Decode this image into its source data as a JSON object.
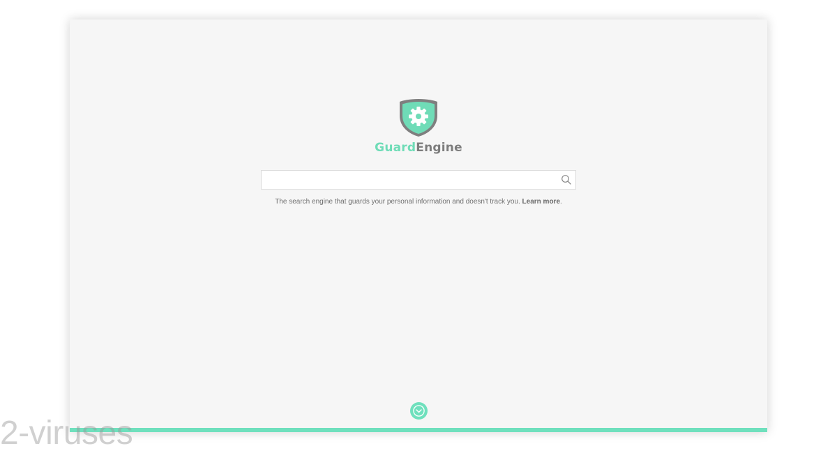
{
  "brand": {
    "part1": "Guard",
    "part2": "Engine",
    "accent_color": "#6fdcb7",
    "secondary_color": "#7d7d7d"
  },
  "search": {
    "value": "",
    "placeholder": "",
    "button_icon": "search-icon"
  },
  "tagline": {
    "text": "The search engine that guards your personal information and doesn't track you. ",
    "link_label": "Learn more",
    "suffix": "."
  },
  "scroll_button": {
    "icon": "chevron-down-circle-icon"
  },
  "watermark": {
    "text": "2-viruses"
  },
  "colors": {
    "page_background": "#f6f6f6",
    "accent_bar": "#6fe0bd"
  }
}
